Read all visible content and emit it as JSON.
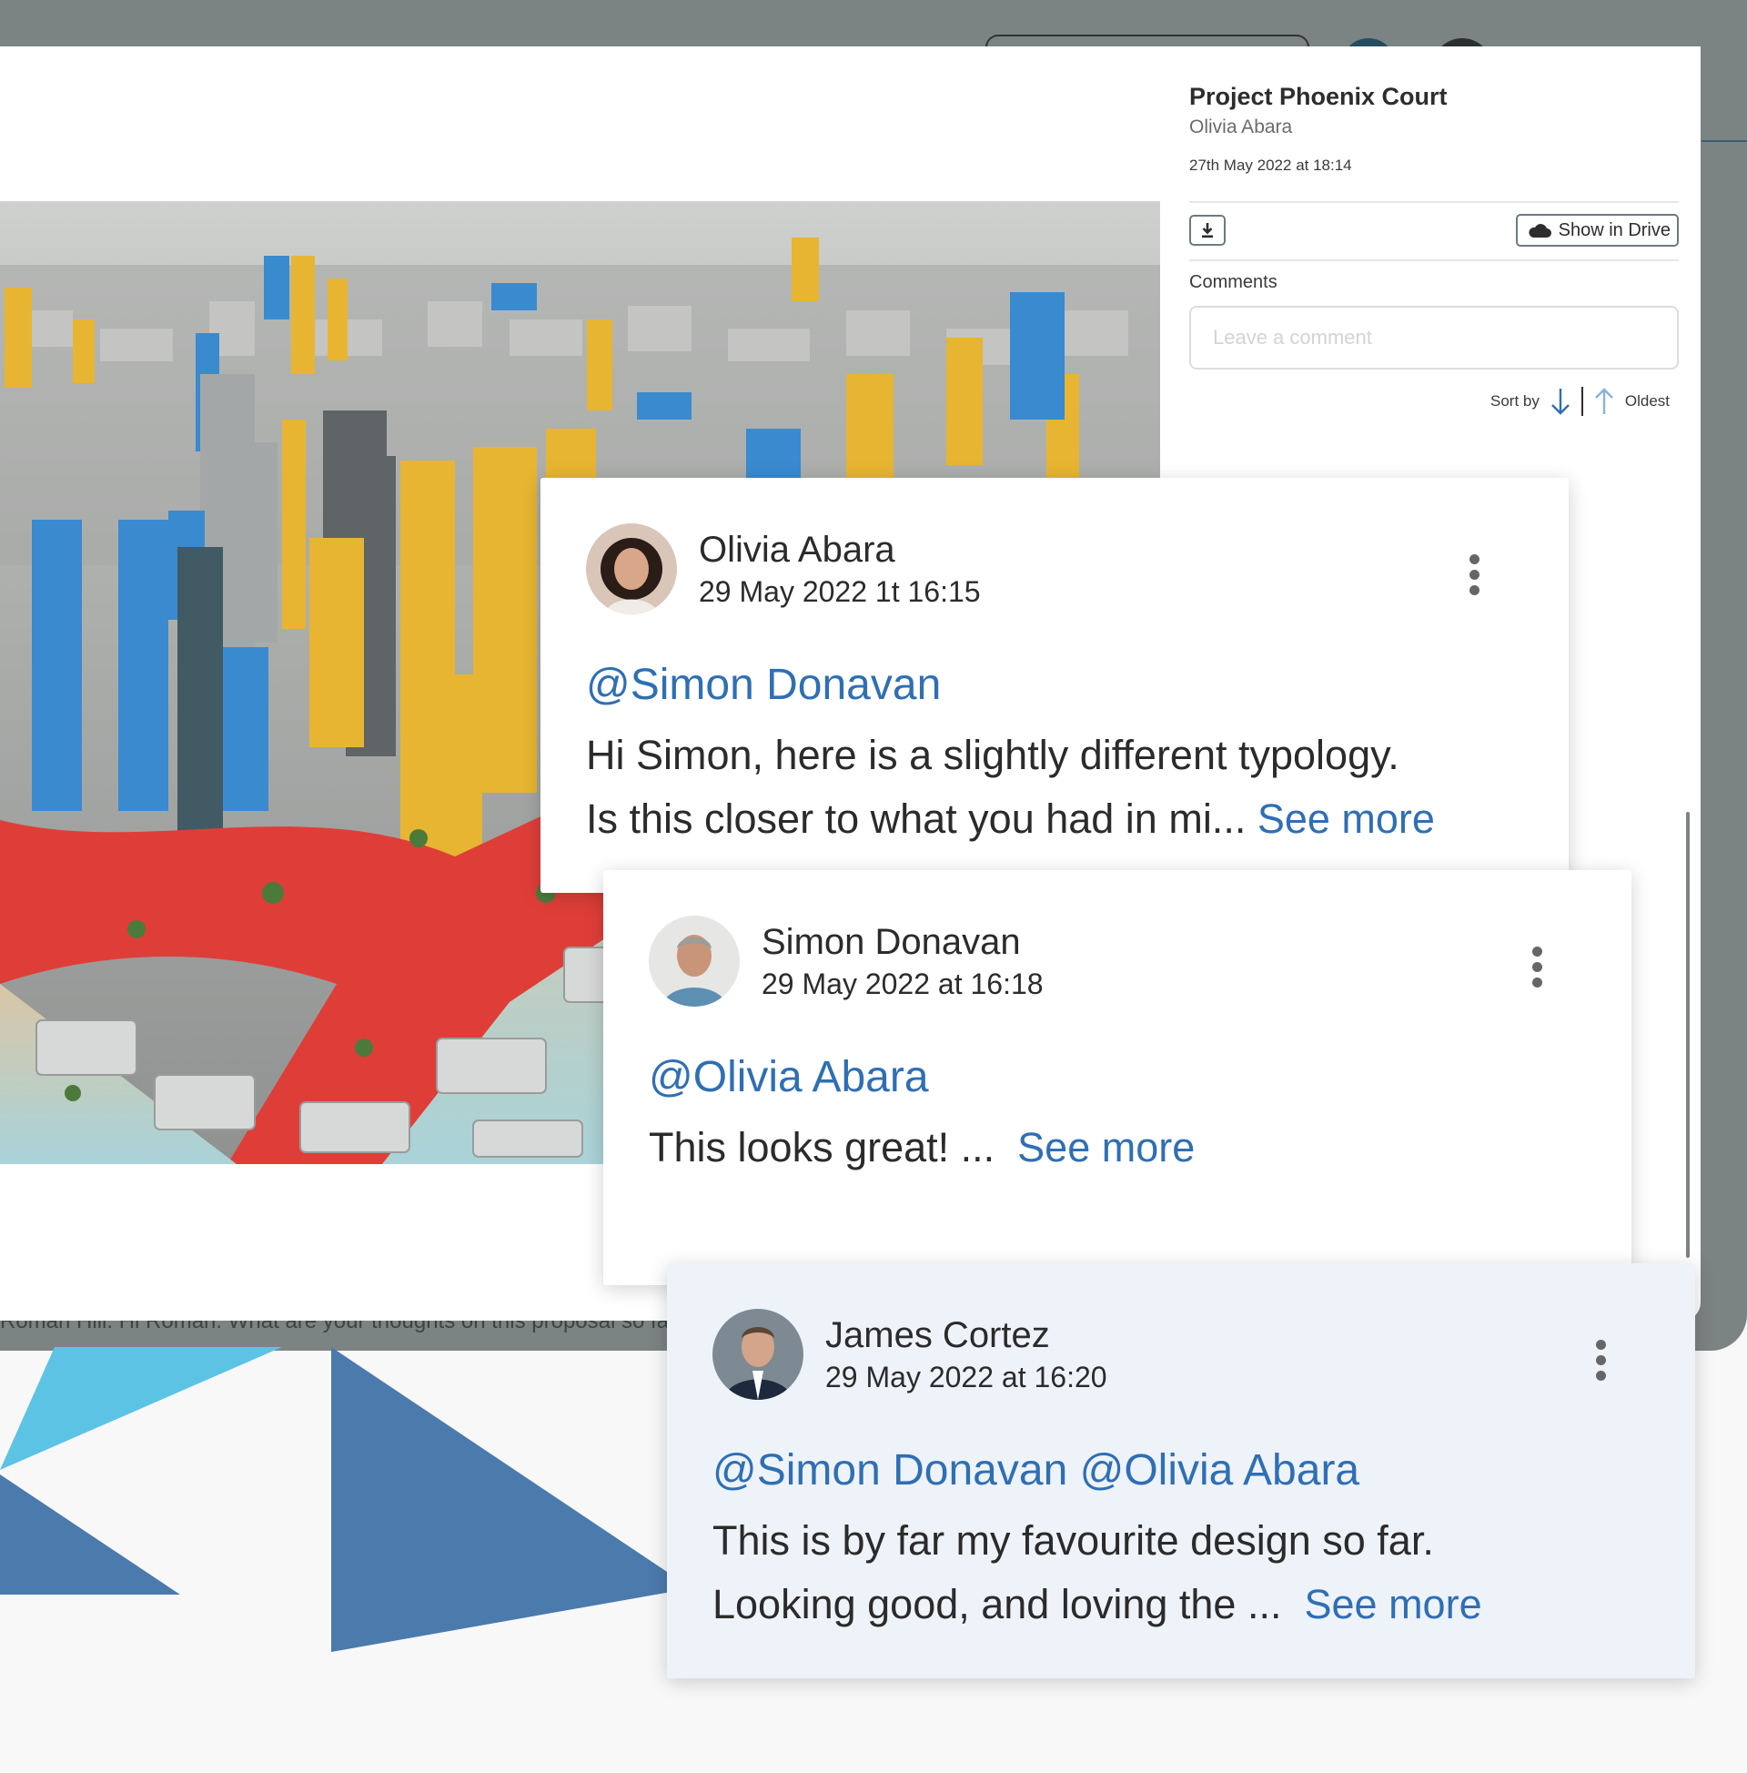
{
  "background": {
    "footer_text": "Roman Hill. Hi Roman. What are your thoughts on this proposal so far?"
  },
  "image": {
    "alt": "3D city massing render",
    "colors": {
      "blue": "#3a8ad0",
      "yellow": "#e7b531",
      "red": "#df3e38",
      "grey": "#bcbcbc"
    }
  },
  "project": {
    "title": "Project Phoenix Court",
    "author": "Olivia Abara",
    "date": "27th May 2022 at 18:14"
  },
  "toolbar": {
    "download_icon": "download-icon",
    "drive_icon": "cloud-icon",
    "drive_label": "Show in Drive"
  },
  "comments": {
    "label": "Comments",
    "placeholder": "Leave a comment",
    "sort_label": "Sort by",
    "sort_value": "Oldest"
  },
  "cards": [
    {
      "name": "Olivia Abara",
      "date": "29 May 2022 1t 16:15",
      "mention": "@Simon Donavan",
      "line1": "Hi Simon, here is a slightly different typology.",
      "line2": "Is this closer to what you had in mi...",
      "see_more": "See more"
    },
    {
      "name": "Simon Donavan",
      "date": "29 May 2022 at 16:18",
      "mention": "@Olivia Abara",
      "line1": "This looks great! ...",
      "see_more": "See more"
    },
    {
      "name": "James Cortez",
      "date": "29 May 2022 at 16:20",
      "mention": "@Simon Donavan @Olivia Abara",
      "line1": "This is by far my favourite design so far.",
      "line2": "Looking good, and loving the ...",
      "see_more": "See more"
    }
  ],
  "colors": {
    "mention": "#2f6fb4",
    "highlight_card": "#eef3fa",
    "deco_dark_blue": "#4b7aad",
    "deco_light_blue": "#5cc3e5"
  }
}
